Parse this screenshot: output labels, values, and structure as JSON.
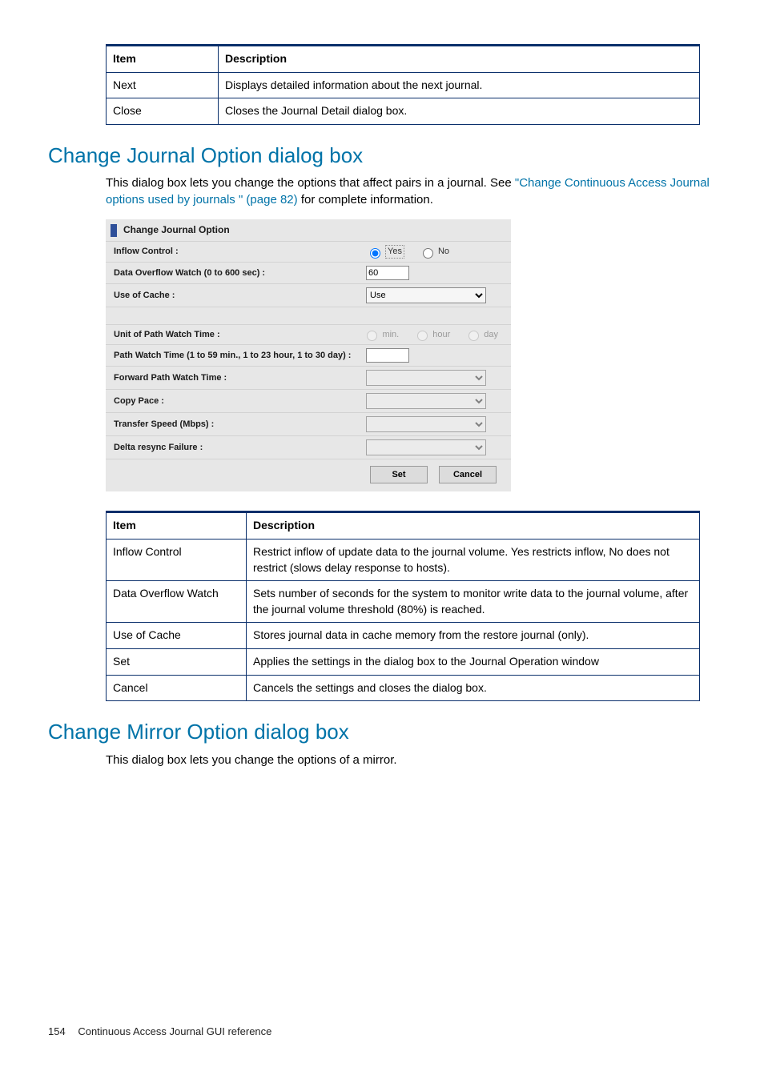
{
  "table1": {
    "headers": [
      "Item",
      "Description"
    ],
    "rows": [
      [
        "Next",
        "Displays detailed information about the next journal."
      ],
      [
        "Close",
        "Closes the Journal Detail dialog box."
      ]
    ]
  },
  "section1": {
    "heading": "Change Journal Option dialog box",
    "intro_pre": "This dialog box lets you change the options that affect pairs in a journal. See ",
    "intro_link": "\"Change Continuous Access Journal options used by journals \" (page 82)",
    "intro_post": " for complete information."
  },
  "dialog": {
    "title": "Change Journal Option",
    "rows": {
      "inflow_label": "Inflow Control :",
      "inflow_yes": "Yes",
      "inflow_no": "No",
      "overflow_label": "Data Overflow Watch (0 to 600 sec) :",
      "overflow_value": "60",
      "cache_label": "Use of Cache :",
      "cache_value": "Use",
      "unit_label": "Unit of Path Watch Time :",
      "unit_min": "min.",
      "unit_hour": "hour",
      "unit_day": "day",
      "pathwatch_label": "Path Watch Time (1 to 59 min., 1 to 23 hour, 1 to 30 day) :",
      "fwd_label": "Forward Path Watch Time :",
      "copy_label": "Copy Pace :",
      "speed_label": "Transfer Speed (Mbps) :",
      "delta_label": "Delta resync Failure :"
    },
    "buttons": {
      "set": "Set",
      "cancel": "Cancel"
    }
  },
  "table2": {
    "headers": [
      "Item",
      "Description"
    ],
    "rows": [
      [
        "Inflow Control",
        "Restrict inflow of update data to the journal volume. Yes restricts inflow, No does not restrict (slows delay response to hosts)."
      ],
      [
        "Data Overflow Watch",
        "Sets number of seconds for the system to monitor write data to the journal volume, after the journal volume threshold (80%) is reached."
      ],
      [
        "Use of Cache",
        "Stores journal data in cache memory from the restore journal (only)."
      ],
      [
        "Set",
        "Applies the settings in the dialog box to the Journal Operation window"
      ],
      [
        "Cancel",
        "Cancels the settings and closes the dialog box."
      ]
    ]
  },
  "section2": {
    "heading": "Change Mirror Option dialog box",
    "intro": "This dialog box lets you change the options of a mirror."
  },
  "footer": {
    "page": "154",
    "title": "Continuous Access Journal GUI reference"
  }
}
